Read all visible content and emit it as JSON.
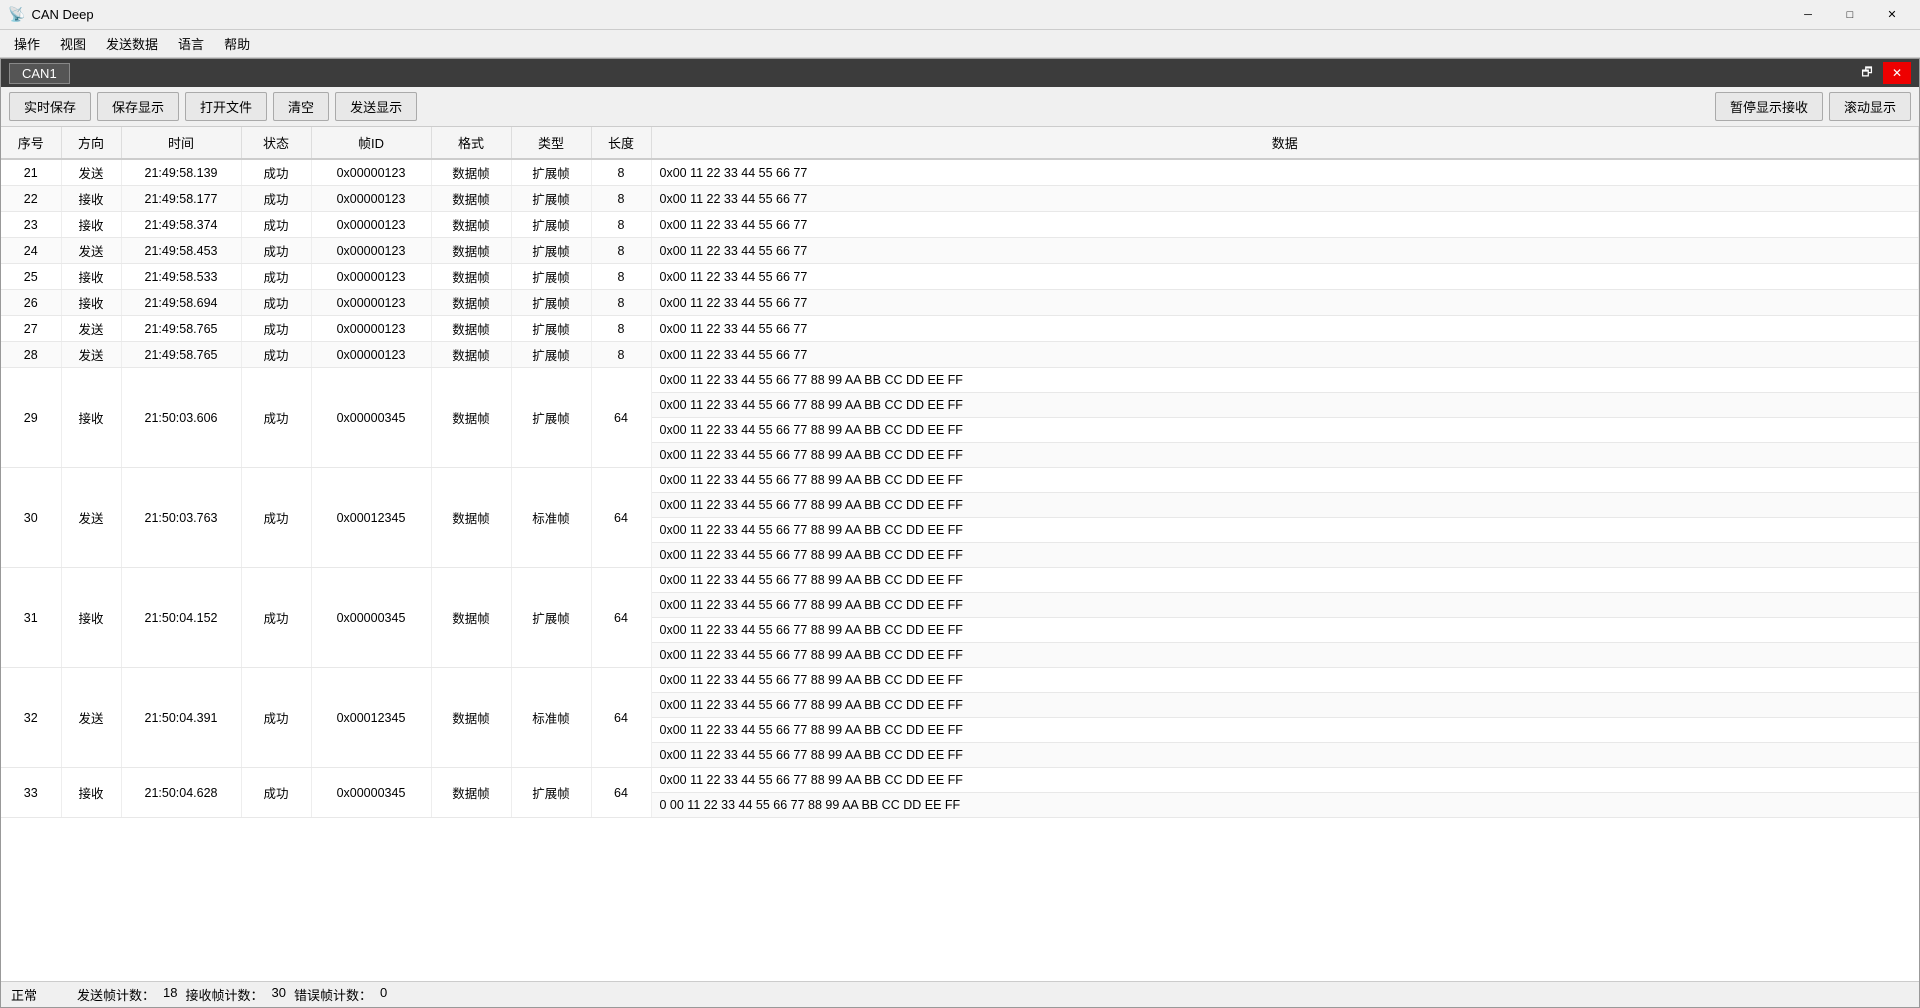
{
  "app": {
    "title": "CAN Deep",
    "icon": "📡"
  },
  "titlebar": {
    "minimize": "─",
    "restore": "□",
    "close": "✕"
  },
  "menu": {
    "items": [
      "操作",
      "视图",
      "发送数据",
      "语言",
      "帮助"
    ]
  },
  "window": {
    "tab": "CAN1",
    "restore_btn": "🗗",
    "close_btn": "✕"
  },
  "toolbar": {
    "btn1": "实时保存",
    "btn2": "保存显示",
    "btn3": "打开文件",
    "btn4": "清空",
    "btn5": "发送显示",
    "btn_pause": "暂停显示接收",
    "btn_scroll": "滚动显示"
  },
  "table": {
    "headers": [
      "序号",
      "方向",
      "时间",
      "状态",
      "帧ID",
      "格式",
      "类型",
      "长度",
      "数据"
    ],
    "rows": [
      {
        "seq": "21",
        "dir": "发送",
        "time": "21:49:58.139",
        "status": "成功",
        "frameid": "0x00000123",
        "format": "数据帧",
        "type": "扩展帧",
        "len": "8",
        "data": [
          "0x00 11 22 33 44 55 66 77"
        ]
      },
      {
        "seq": "22",
        "dir": "接收",
        "time": "21:49:58.177",
        "status": "成功",
        "frameid": "0x00000123",
        "format": "数据帧",
        "type": "扩展帧",
        "len": "8",
        "data": [
          "0x00 11 22 33 44 55 66 77"
        ]
      },
      {
        "seq": "23",
        "dir": "接收",
        "time": "21:49:58.374",
        "status": "成功",
        "frameid": "0x00000123",
        "format": "数据帧",
        "type": "扩展帧",
        "len": "8",
        "data": [
          "0x00 11 22 33 44 55 66 77"
        ]
      },
      {
        "seq": "24",
        "dir": "发送",
        "time": "21:49:58.453",
        "status": "成功",
        "frameid": "0x00000123",
        "format": "数据帧",
        "type": "扩展帧",
        "len": "8",
        "data": [
          "0x00 11 22 33 44 55 66 77"
        ]
      },
      {
        "seq": "25",
        "dir": "接收",
        "time": "21:49:58.533",
        "status": "成功",
        "frameid": "0x00000123",
        "format": "数据帧",
        "type": "扩展帧",
        "len": "8",
        "data": [
          "0x00 11 22 33 44 55 66 77"
        ]
      },
      {
        "seq": "26",
        "dir": "接收",
        "time": "21:49:58.694",
        "status": "成功",
        "frameid": "0x00000123",
        "format": "数据帧",
        "type": "扩展帧",
        "len": "8",
        "data": [
          "0x00 11 22 33 44 55 66 77"
        ]
      },
      {
        "seq": "27",
        "dir": "发送",
        "time": "21:49:58.765",
        "status": "成功",
        "frameid": "0x00000123",
        "format": "数据帧",
        "type": "扩展帧",
        "len": "8",
        "data": [
          "0x00 11 22 33 44 55 66 77"
        ]
      },
      {
        "seq": "28",
        "dir": "发送",
        "time": "21:49:58.765",
        "status": "成功",
        "frameid": "0x00000123",
        "format": "数据帧",
        "type": "扩展帧",
        "len": "8",
        "data": [
          "0x00 11 22 33 44 55 66 77"
        ]
      },
      {
        "seq": "29",
        "dir": "接收",
        "time": "21:50:03.606",
        "status": "成功",
        "frameid": "0x00000345",
        "format": "数据帧",
        "type": "扩展帧",
        "len": "64",
        "data": [
          "0x00 11 22 33 44 55 66 77  88 99 AA BB CC DD EE FF",
          "0x00 11 22 33 44 55 66 77  88 99 AA BB CC DD EE FF",
          "0x00 11 22 33 44 55 66 77  88 99 AA BB CC DD EE FF",
          "0x00 11 22 33 44 55 66 77  88 99 AA BB CC DD EE FF"
        ]
      },
      {
        "seq": "30",
        "dir": "发送",
        "time": "21:50:03.763",
        "status": "成功",
        "frameid": "0x00012345",
        "format": "数据帧",
        "type": "标准帧",
        "len": "64",
        "data": [
          "0x00 11 22 33 44 55 66 77  88 99 AA BB CC DD EE FF",
          "0x00 11 22 33 44 55 66 77  88 99 AA BB CC DD EE FF",
          "0x00 11 22 33 44 55 66 77  88 99 AA BB CC DD EE FF",
          "0x00 11 22 33 44 55 66 77  88 99 AA BB CC DD EE FF"
        ]
      },
      {
        "seq": "31",
        "dir": "接收",
        "time": "21:50:04.152",
        "status": "成功",
        "frameid": "0x00000345",
        "format": "数据帧",
        "type": "扩展帧",
        "len": "64",
        "data": [
          "0x00 11 22 33 44 55 66 77  88 99 AA BB CC DD EE FF",
          "0x00 11 22 33 44 55 66 77  88 99 AA BB CC DD EE FF",
          "0x00 11 22 33 44 55 66 77  88 99 AA BB CC DD EE FF",
          "0x00 11 22 33 44 55 66 77  88 99 AA BB CC DD EE FF"
        ]
      },
      {
        "seq": "32",
        "dir": "发送",
        "time": "21:50:04.391",
        "status": "成功",
        "frameid": "0x00012345",
        "format": "数据帧",
        "type": "标准帧",
        "len": "64",
        "data": [
          "0x00 11 22 33 44 55 66 77  88 99 AA BB CC DD EE FF",
          "0x00 11 22 33 44 55 66 77  88 99 AA BB CC DD EE FF",
          "0x00 11 22 33 44 55 66 77  88 99 AA BB CC DD EE FF",
          "0x00 11 22 33 44 55 66 77  88 99 AA BB CC DD EE FF"
        ]
      },
      {
        "seq": "33",
        "dir": "接收",
        "time": "21:50:04.628",
        "status": "成功",
        "frameid": "0x00000345",
        "format": "数据帧",
        "type": "扩展帧",
        "len": "64",
        "data": [
          "0x00 11 22 33 44 55 66 77  88 99 AA BB CC DD EE FF",
          "0 00 11 22 33 44 55 66 77  88 99 AA BB CC DD EE FF"
        ]
      }
    ]
  },
  "statusbar": {
    "status_label": "正常",
    "send_label": "发送帧计数：",
    "send_count": "18",
    "recv_label": "接收帧计数：",
    "recv_count": "30",
    "error_label": "错误帧计数：",
    "error_count": "0"
  }
}
